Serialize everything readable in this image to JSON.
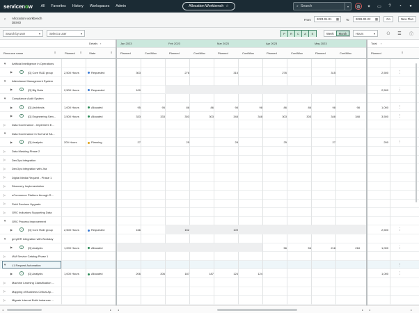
{
  "nav": {
    "logo_pre": "servicen",
    "logo_o": "o",
    "logo_post": "w",
    "items": [
      "All",
      "Favorites",
      "History",
      "Workspaces",
      "Admin"
    ],
    "workbench_label": "Allocation Workbench",
    "search_placeholder": "Search"
  },
  "header": {
    "title": "Allocation workbench",
    "subtitle": "DEMO",
    "from_label": "From",
    "from_value": "2023-01-01",
    "to_label": "To",
    "to_value": "2026-02-22",
    "go_label": "Go",
    "new_plan_label": "New Plan"
  },
  "toolbar": {
    "search_by": "Search by user",
    "select_user": "Select a user",
    "filters": [
      "P",
      "R",
      "C",
      "A",
      "E"
    ],
    "week_label": "Week",
    "month_label": "Month",
    "unit": "Hours"
  },
  "columns": {
    "details": "Details",
    "resource_name": "Resource name",
    "planned": "Planned",
    "state": "State",
    "months": [
      "Jan 2023",
      "Feb 2023",
      "Mar 2023",
      "Apr 2023",
      "May 2023"
    ],
    "planned_sub": "Planned",
    "confalloc_sub": "ConfAlloc",
    "total": "Total"
  },
  "colors": {
    "requested": "#3a7bd5",
    "allocated": "#2e8b57",
    "planning": "#e0a21a"
  },
  "rows": [
    {
      "level": 0,
      "name": "Artificial Intelligence in Operations",
      "expanded": true
    },
    {
      "level": 1,
      "name": "[G] Core R&D group",
      "planned": "2,500 Hours",
      "state": "Requested",
      "dot": "requested",
      "vals": [
        "303",
        "",
        "276",
        "",
        "315",
        "",
        "276",
        "",
        "315",
        "",
        ""
      ],
      "total": "2,500"
    },
    {
      "level": 0,
      "name": "Attendance Management System",
      "expanded": true
    },
    {
      "level": 1,
      "name": "[G] Big Data",
      "planned": "2,500 Hours",
      "state": "Requested",
      "dot": "requested",
      "vals": [
        "100",
        "",
        "",
        "",
        "",
        "",
        "",
        "",
        "",
        "",
        ""
      ],
      "total": "2,500",
      "grey": true
    },
    {
      "level": 0,
      "name": "Compliance Audit System",
      "expanded": true
    },
    {
      "level": 1,
      "name": "[G] Architects",
      "planned": "1,000 Hours",
      "state": "Allocated",
      "dot": "allocated",
      "vals": [
        "95",
        "95",
        "86",
        "86",
        "98",
        "98",
        "86",
        "86",
        "98",
        "98",
        ""
      ],
      "total": "1,000"
    },
    {
      "level": 1,
      "name": "[G] Engineering Serv...",
      "planned": "3,500 Hours",
      "state": "Allocated",
      "dot": "allocated",
      "vals": [
        "333",
        "333",
        "303",
        "303",
        "348",
        "348",
        "303",
        "303",
        "348",
        "348",
        ""
      ],
      "total": "3,500"
    },
    {
      "level": 0,
      "name": "Data Governance - Implement E...",
      "expanded": false
    },
    {
      "level": 0,
      "name": "Data Governance in Surf and SA...",
      "expanded": true
    },
    {
      "level": 1,
      "name": "[G] Analysts",
      "planned": "200 Hours",
      "state": "Planning",
      "dot": "planning",
      "vals": [
        "27",
        "",
        "25",
        "",
        "28",
        "",
        "25",
        "",
        "27",
        "",
        ""
      ],
      "total": "200"
    },
    {
      "level": 0,
      "name": "Data Masking Phase 2",
      "expanded": false
    },
    {
      "level": 0,
      "name": "DevOps Integration",
      "expanded": false
    },
    {
      "level": 0,
      "name": "DevOps Integration with Jira",
      "expanded": false
    },
    {
      "level": 0,
      "name": "Digital Media Request - Phase 1",
      "expanded": false
    },
    {
      "level": 0,
      "name": "Discovery Implementation",
      "expanded": false
    },
    {
      "level": 0,
      "name": "eCommerce Platform through R...",
      "expanded": false
    },
    {
      "level": 0,
      "name": "Field Services Upgrade",
      "expanded": false
    },
    {
      "level": 0,
      "name": "GRC Indicators Supporting Data",
      "expanded": false
    },
    {
      "level": 0,
      "name": "GRC Process Improvement",
      "expanded": true
    },
    {
      "level": 1,
      "name": "[G] Core R&D group",
      "planned": "2,500 Hours",
      "state": "Requested",
      "dot": "requested",
      "vals": [
        "166",
        "",
        "152",
        "",
        "109",
        "",
        "",
        "",
        "",
        "",
        ""
      ],
      "total": "2,500",
      "grey": true
    },
    {
      "level": 0,
      "name": "greytHR integration with Workday",
      "expanded": true
    },
    {
      "level": 1,
      "name": "[G] Analysts",
      "planned": "1,000 Hours",
      "state": "Allocated",
      "dot": "allocated",
      "vals": [
        "",
        "",
        "",
        "",
        "",
        "",
        "56",
        "56",
        "218",
        "218",
        ""
      ],
      "total": "1,000",
      "greyLeft": true
    },
    {
      "level": 0,
      "name": "IAM Service Catalog Phase 1",
      "expanded": false
    },
    {
      "level": 0,
      "name": "L1 Request Automation",
      "expanded": true,
      "selected": true
    },
    {
      "level": 1,
      "name": "[G] Analysts",
      "planned": "1,000 Hours",
      "state": "Allocated",
      "dot": "allocated",
      "vals": [
        "206",
        "206",
        "187",
        "187",
        "124",
        "124",
        "",
        "",
        "",
        "",
        ""
      ],
      "total": "1,000"
    },
    {
      "level": 0,
      "name": "Machine Learning Classification ...",
      "expanded": false
    },
    {
      "level": 0,
      "name": "Mapping of Business Critical Ap...",
      "expanded": false
    },
    {
      "level": 0,
      "name": "Migrate Internal Build instances ...",
      "expanded": false
    }
  ]
}
